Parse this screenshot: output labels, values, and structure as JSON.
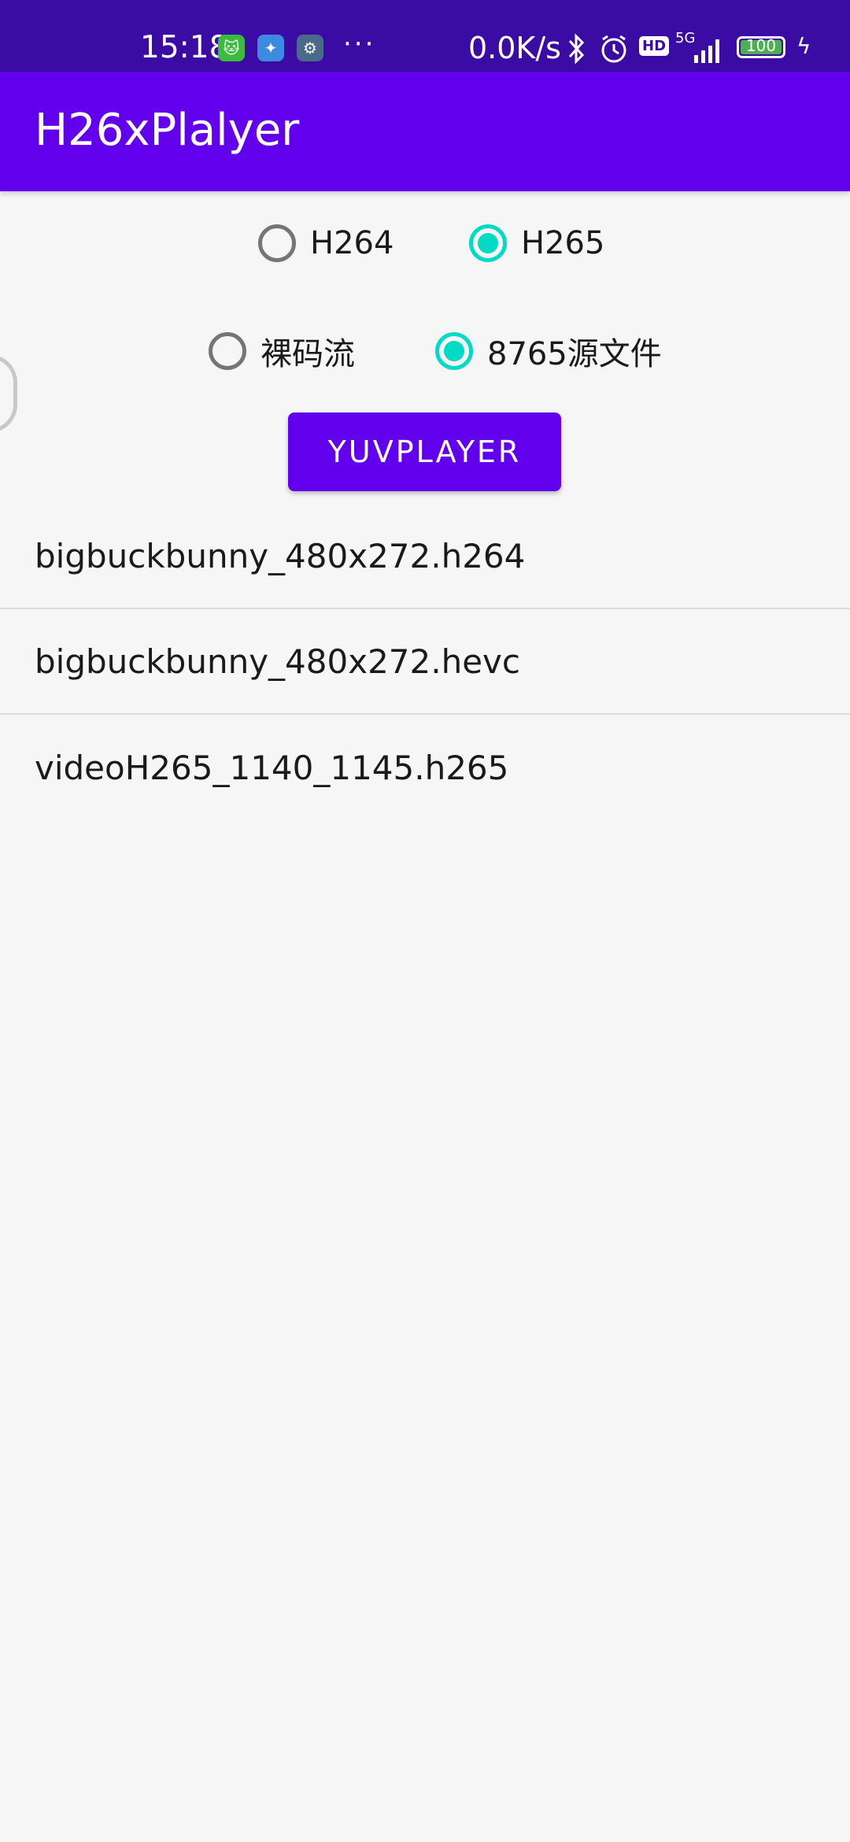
{
  "status_bar": {
    "time": "15:18",
    "dots": "···",
    "network_speed": "0.0K/s",
    "network_type": "5G",
    "hd_badge": "HD",
    "battery": "100",
    "icons": [
      "cat-app-icon",
      "bird-app-icon",
      "settings-app-icon",
      "bluetooth-icon",
      "alarm-icon",
      "hd-icon",
      "signal-icon",
      "battery-icon",
      "charging-icon"
    ]
  },
  "app_bar": {
    "title": "H26xPlalyer"
  },
  "codec_options": [
    {
      "label": "H264",
      "checked": false
    },
    {
      "label": "H265",
      "checked": true
    }
  ],
  "source_options": [
    {
      "label": "裸码流",
      "checked": false
    },
    {
      "label": "8765源文件",
      "checked": true
    }
  ],
  "primary_button": {
    "label": "YUVPLAYER"
  },
  "files": [
    "bigbuckbunny_480x272.h264",
    "bigbuckbunny_480x272.hevc",
    "videoH265_1140_1145.h265"
  ],
  "colors": {
    "status_bar": "#3a0ca3",
    "app_bar": "#6200ee",
    "accent": "#03dac5",
    "background": "#f6f6f6"
  }
}
